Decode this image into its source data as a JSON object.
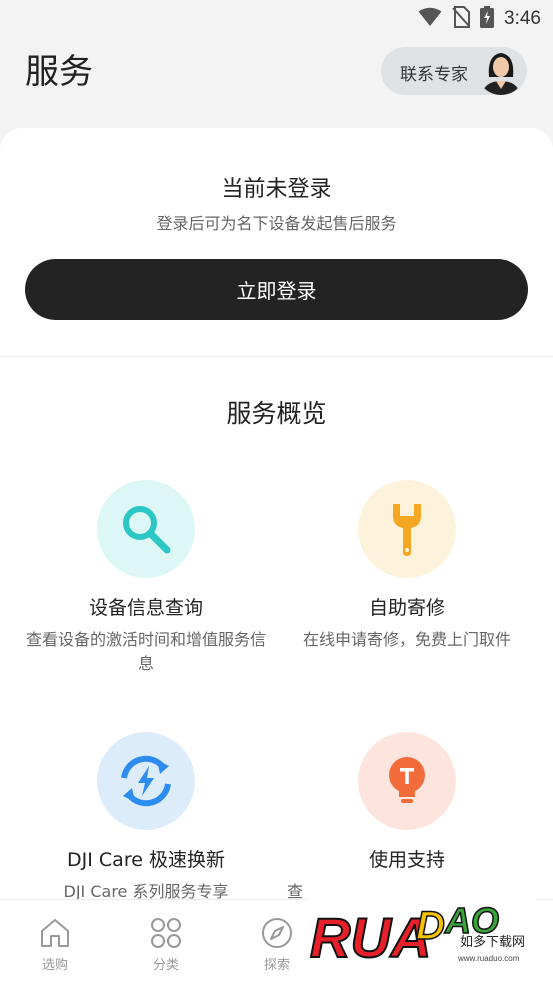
{
  "status_bar": {
    "time": "3:46"
  },
  "header": {
    "title": "服务",
    "contact_label": "联系专家"
  },
  "login": {
    "title": "当前未登录",
    "subtitle": "登录后可为名下设备发起售后服务",
    "button_label": "立即登录"
  },
  "overview": {
    "title": "服务概览",
    "items": [
      {
        "title": "设备信息查询",
        "desc": "查看设备的激活时间和增值服务信息",
        "icon": "search-icon",
        "color": "#2cc7c4"
      },
      {
        "title": "自助寄修",
        "desc": "在线申请寄修，免费上门取件",
        "icon": "wrench-icon",
        "color": "#f5a623"
      },
      {
        "title": "DJI Care 极速换新",
        "desc": "DJI Care 系列服务专享",
        "icon": "refresh-bolt-icon",
        "color": "#2d8cf0"
      },
      {
        "title": "使用支持",
        "desc": "查",
        "icon": "lightbulb-icon",
        "color": "#f26b3a"
      }
    ]
  },
  "bottom_nav": {
    "items": [
      {
        "label": "选购",
        "icon": "home-icon"
      },
      {
        "label": "分类",
        "icon": "grid-icon"
      },
      {
        "label": "探索",
        "icon": "compass-icon"
      }
    ]
  },
  "watermark": {
    "brand": "RUAODAO",
    "tagline": "如多下载网",
    "url": "www.ruaduo.com"
  }
}
